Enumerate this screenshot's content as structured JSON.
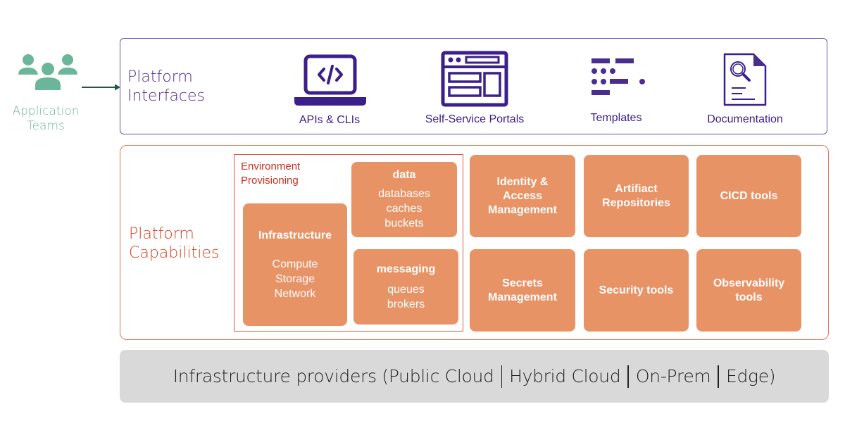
{
  "colors": {
    "teams": "#6bb69a",
    "interfaces": "#4b2d8f",
    "capabilities": "#d8401f",
    "tile": "#e79366",
    "providers_bg": "#d9d9d9"
  },
  "teams": {
    "icon": "people-group-icon",
    "label_line1": "Application",
    "label_line2": "Teams"
  },
  "interfaces": {
    "title_line1": "Platform",
    "title_line2": "Interfaces",
    "items": [
      {
        "icon": "laptop-code-icon",
        "label": "APIs & CLIs"
      },
      {
        "icon": "browser-window-icon",
        "label": "Self-Service Portals"
      },
      {
        "icon": "template-blocks-icon",
        "label": "Templates"
      },
      {
        "icon": "document-search-icon",
        "label": "Documentation"
      }
    ]
  },
  "capabilities": {
    "title_line1": "Platform",
    "title_line2": "Capabilities",
    "environment": {
      "title_line1": "Environment",
      "title_line2": "Provisioning",
      "infrastructure": {
        "title": "Infrastructure",
        "items": [
          "Compute",
          "Storage",
          "Network"
        ]
      },
      "data": {
        "title": "data",
        "items": [
          "databases",
          "caches",
          "buckets"
        ]
      },
      "messaging": {
        "title": "messaging",
        "items": [
          "queues",
          "brokers"
        ]
      }
    },
    "tiles": [
      {
        "line1": "Identity &",
        "line2": "Access",
        "line3": "Management"
      },
      {
        "line1": "Artifiact",
        "line2": "Repositories"
      },
      {
        "line1": "CICD tools"
      },
      {
        "line1": "Secrets",
        "line2": "Management"
      },
      {
        "line1": "Security tools"
      },
      {
        "line1": "Observability",
        "line2": "tools"
      }
    ]
  },
  "providers": {
    "prefix": "Infrastructure providers (Public Cloud",
    "part2": "Hybrid Cloud",
    "part3": "On-Prem",
    "suffix": "Edge)"
  }
}
